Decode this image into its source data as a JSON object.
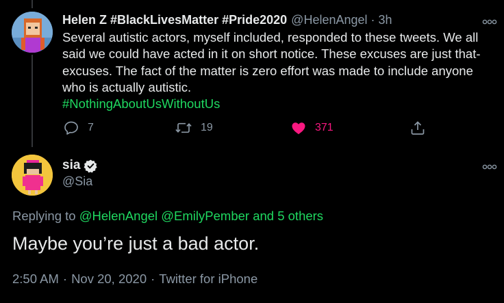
{
  "colors": {
    "background": "#000000",
    "text_primary": "#e7e9ea",
    "text_secondary": "#8b98a5",
    "accent_green": "#1fd860",
    "like_pink": "#f91880"
  },
  "tweet1": {
    "display_name": "Helen Z #BlackLivesMatter #Pride2020",
    "handle": "@HelenAngel",
    "separator": "·",
    "time": "3h",
    "body_lines": [
      "Several autistic actors, myself included, responded to these tweets. We all",
      "said we could have acted in it on short notice. These excuses are just that-",
      "excuses. The fact of the matter is zero effort was made to include anyone",
      "who is actually autistic."
    ],
    "hashtag": "#NothingAboutUsWithoutUs",
    "actions": {
      "reply_count": "7",
      "retweet_count": "19",
      "like_count": "371"
    },
    "icons": {
      "reply": "reply-icon",
      "retweet": "retweet-icon",
      "like": "heart-filled-icon",
      "share": "share-icon",
      "more": "more-icon"
    }
  },
  "tweet2": {
    "display_name": "sia",
    "verified_icon": "verified-badge-icon",
    "handle": "@Sia",
    "replying_to_label": "Replying to",
    "mentions": [
      "@HelenAngel",
      "@EmilyPember",
      "and 5 others"
    ],
    "body": "Maybe you’re just a bad actor.",
    "time": "2:50 AM",
    "date": "Nov 20, 2020",
    "source": "Twitter for iPhone",
    "meta_separator": "·"
  }
}
